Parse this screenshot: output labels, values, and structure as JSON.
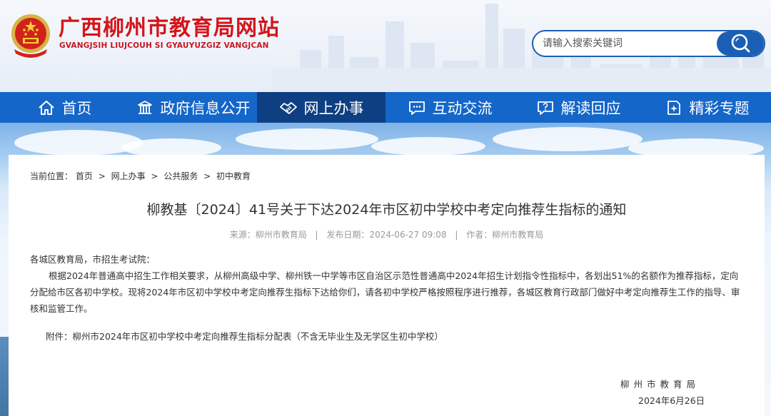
{
  "header": {
    "site_title": "广西柳州市教育局网站",
    "site_subtitle": "GVANGJSIH LIUJCOUH SI GYAUYUZGIZ VANGJCAN",
    "emblem_icon": "national-emblem-icon",
    "search": {
      "placeholder": "请输入搜索关键词",
      "value": "",
      "icon": "search-icon"
    }
  },
  "nav": {
    "items": [
      {
        "label": "首页",
        "icon": "home-icon",
        "active": false
      },
      {
        "label": "政府信息公开",
        "icon": "building-icon",
        "active": false
      },
      {
        "label": "网上办事",
        "icon": "handshake-icon",
        "active": true
      },
      {
        "label": "互动交流",
        "icon": "chat-icon",
        "active": false
      },
      {
        "label": "解读回应",
        "icon": "question-bubble-icon",
        "active": false
      },
      {
        "label": "精彩专题",
        "icon": "sparkle-doc-icon",
        "active": false
      }
    ]
  },
  "breadcrumb": {
    "prefix": "当前位置：",
    "items": [
      "首页",
      "网上办事",
      "公共服务",
      "初中教育"
    ],
    "separator": ">"
  },
  "article": {
    "title": "柳教基〔2024〕41号关于下达2024年市区初中学校中考定向推荐生指标的通知",
    "meta": {
      "source_label": "来源：",
      "source": "柳州市教育局",
      "date_label": "发布日期：",
      "date": "2024-06-27 09:08",
      "author_label": "作者：",
      "author": "柳州市教育局",
      "divider": "|"
    },
    "salutation": "各城区教育局，市招生考试院：",
    "paragraph": "根据2024年普通高中招生工作相关要求，从柳州高级中学、柳州铁一中学等市区自治区示范性普通高中2024年招生计划指令性指标中，各划出51%的名额作为推荐指标，定向分配给市区各初中学校。现将2024年市区初中学校中考定向推荐生指标下达给你们，请各初中学校严格按照程序进行推荐，各城区教育行政部门做好中考定向推荐生工作的指导、审核和监管工作。",
    "attachment": "附件：柳州市2024年市区初中学校中考定向推荐生指标分配表（不含无毕业生及无学区生初中学校）",
    "signer": "柳州市教育局",
    "sign_date": "2024年6月26日"
  },
  "colors": {
    "brand_red": "#d4141b",
    "nav_blue": "#1566c9",
    "nav_active": "#0d3f82",
    "search_blue": "#1b5fb4"
  }
}
